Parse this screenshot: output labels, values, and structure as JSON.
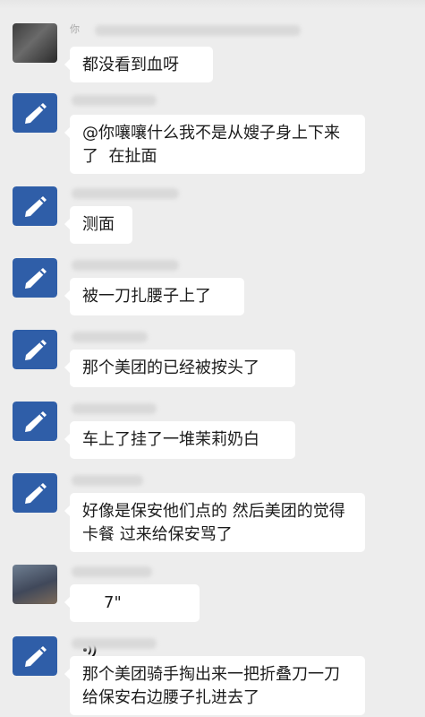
{
  "messages": [
    {
      "sender_partial": "你",
      "text": "都没看到血呀"
    },
    {
      "sender_partial": "",
      "text": "@你嚷嚷什么我不是从嫂子身上下来了  在扯面"
    },
    {
      "sender_partial": "",
      "text": "测面"
    },
    {
      "sender_partial": "",
      "text": "被一刀扎腰子上了"
    },
    {
      "sender_partial": "",
      "text": "那个美团的已经被按头了"
    },
    {
      "sender_partial": "",
      "text": "车上了挂了一堆茉莉奶白"
    },
    {
      "sender_partial": "",
      "text": "好像是保安他们点的 然后美团的觉得卡餐 过来给保安骂了"
    },
    {
      "sender_partial": "",
      "voice_duration": "7\""
    },
    {
      "sender_partial": "",
      "text": "那个美团骑手掏出来一把折叠刀一刀给保安右边腰子扎进去了"
    }
  ],
  "icons": {
    "pen_avatar": "pen-icon",
    "voice": "voice-wave-icon"
  },
  "colors": {
    "background": "#ededed",
    "bubble": "#ffffff",
    "avatar_blue": "#2f5ea8"
  }
}
